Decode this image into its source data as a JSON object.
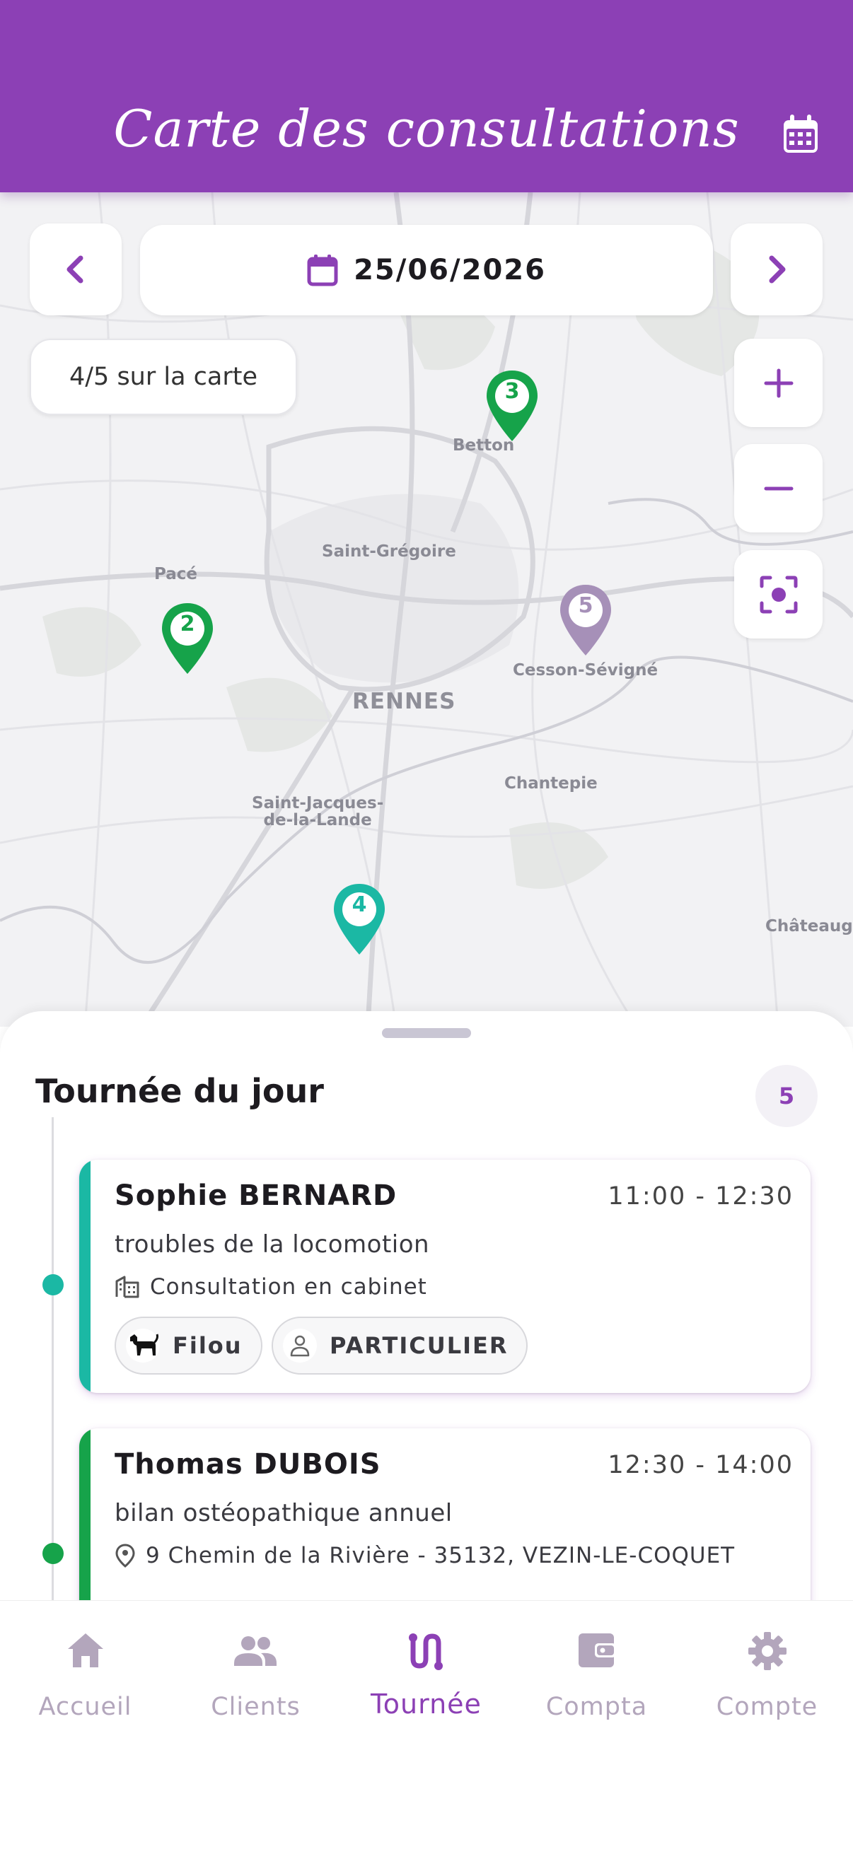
{
  "header": {
    "title": "Carte des consultations",
    "calendar_icon": "calendar-icon",
    "bg_color": "#8c40b5"
  },
  "map": {
    "date": "25/06/2026",
    "count_label": "4/5 sur la carte",
    "places": {
      "betton": "Betton",
      "saint_gregoire": "Saint-Grégoire",
      "pace": "Pacé",
      "cesson": "Cesson-Sévigné",
      "rennes": "RENNES",
      "chantepie": "Chantepie",
      "saint_jacques_1": "Saint-Jacques-",
      "saint_jacques_2": "de-la-Lande",
      "chateaugiron": "Châteaug"
    },
    "markers": [
      {
        "label": "3",
        "color": "#16a34a"
      },
      {
        "label": "2",
        "color": "#16a34a"
      },
      {
        "label": "5",
        "color": "#a690b8"
      },
      {
        "label": "4",
        "color": "#1bb8a4"
      }
    ]
  },
  "sheet": {
    "title": "Tournée du jour",
    "count": "5",
    "consultations": [
      {
        "name": "Sophie BERNARD",
        "time": "11:00 - 12:30",
        "reason": "troubles de la locomotion",
        "location": "Consultation en cabinet",
        "location_icon": "building-icon",
        "animal": "Filou",
        "animal_icon": "dog-icon",
        "client_type": "PARTICULIER",
        "client_icon": "person-icon",
        "accent": "#1bb8a4"
      },
      {
        "name": "Thomas DUBOIS",
        "time": "12:30 - 14:00",
        "reason": "bilan ostéopathique annuel",
        "location": "9 Chemin de la Rivière - 35132, VEZIN-LE-COQUET",
        "location_icon": "pin-icon",
        "accent": "#16a34a"
      }
    ]
  },
  "nav": {
    "items": [
      {
        "label": "Accueil",
        "icon": "home-icon"
      },
      {
        "label": "Clients",
        "icon": "people-icon"
      },
      {
        "label": "Tournée",
        "icon": "route-icon"
      },
      {
        "label": "Compta",
        "icon": "wallet-icon"
      },
      {
        "label": "Compte",
        "icon": "gear-icon"
      }
    ],
    "active_color": "#8c40b5",
    "inactive_color": "#b3a6bc"
  }
}
